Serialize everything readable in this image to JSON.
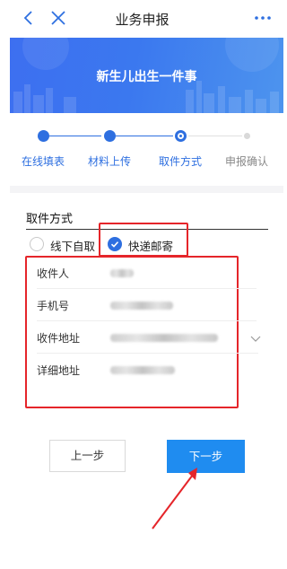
{
  "header": {
    "title": "业务申报",
    "back_icon": "chevron-left-icon",
    "close_icon": "close-icon",
    "more_icon": "more-dots-icon",
    "accent": "#2e6fe0"
  },
  "banner": {
    "title": "新生儿出生一件事"
  },
  "steps": [
    {
      "label": "在线填表",
      "state": "done"
    },
    {
      "label": "材料上传",
      "state": "done"
    },
    {
      "label": "取件方式",
      "state": "current"
    },
    {
      "label": "申报确认",
      "state": "pending"
    }
  ],
  "pickup": {
    "section_title": "取件方式",
    "options": [
      {
        "label": "线下自取",
        "selected": false
      },
      {
        "label": "快递邮寄",
        "selected": true
      }
    ]
  },
  "form": {
    "fields": [
      {
        "label": "收件人",
        "value": "",
        "redacted": true
      },
      {
        "label": "手机号",
        "value": "",
        "redacted": true
      },
      {
        "label": "收件地址",
        "value": "",
        "redacted": true,
        "dropdown": true
      },
      {
        "label": "详细地址",
        "value": "",
        "redacted": true
      }
    ]
  },
  "buttons": {
    "prev_label": "上一步",
    "next_label": "下一步",
    "next_color": "#1f8cf0"
  },
  "annotations": {
    "highlight_color": "#e5252a"
  }
}
